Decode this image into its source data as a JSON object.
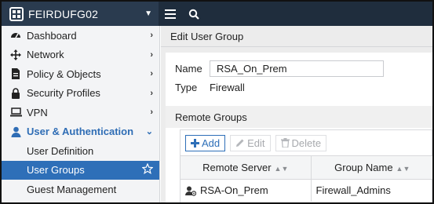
{
  "topbar": {
    "device_name": "FEIRDUFG02",
    "icons": [
      "device-logo-icon",
      "caret-down-icon",
      "hamburger-menu-icon",
      "search-icon"
    ]
  },
  "sidebar": {
    "items": [
      {
        "label": "Dashboard",
        "icon": "dashboard-icon"
      },
      {
        "label": "Network",
        "icon": "network-move-icon"
      },
      {
        "label": "Policy & Objects",
        "icon": "policy-icon"
      },
      {
        "label": "Security Profiles",
        "icon": "lock-icon"
      },
      {
        "label": "VPN",
        "icon": "laptop-icon"
      },
      {
        "label": "User & Authentication",
        "icon": "user-icon"
      }
    ],
    "sub_items": [
      {
        "label": "User Definition"
      },
      {
        "label": "User Groups"
      },
      {
        "label": "Guest Management"
      }
    ]
  },
  "main": {
    "page_title": "Edit User Group",
    "form": {
      "name_label": "Name",
      "name_value": "RSA_On_Prem",
      "type_label": "Type",
      "type_value": "Firewall"
    },
    "remote_groups": {
      "title": "Remote Groups",
      "toolbar": {
        "add_label": "Add",
        "edit_label": "Edit",
        "delete_label": "Delete"
      },
      "columns": [
        "Remote Server",
        "Group Name"
      ],
      "rows": [
        {
          "remote_server": "RSA-On_Prem",
          "group_name": "Firewall_Admins"
        }
      ]
    }
  },
  "colors": {
    "topbar_bg": "#1f2d3d",
    "accent": "#2e6fb8",
    "sidebar_bg": "#f3f4f6"
  }
}
